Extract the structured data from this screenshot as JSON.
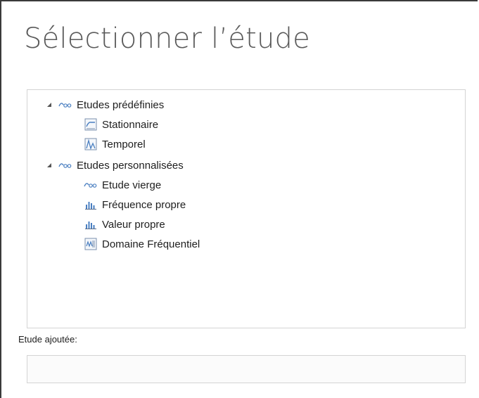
{
  "window": {
    "title": "Sélectionner l’étude"
  },
  "tree": {
    "groups": [
      {
        "label": "Etudes prédéfinies",
        "icon": "study-group-icon",
        "expanded": true,
        "items": [
          {
            "label": "Stationnaire",
            "icon": "stationary-study-icon"
          },
          {
            "label": "Temporel",
            "icon": "time-dependent-study-icon"
          }
        ]
      },
      {
        "label": "Etudes personnalisées",
        "icon": "study-group-icon",
        "expanded": true,
        "items": [
          {
            "label": "Etude vierge",
            "icon": "study-group-icon"
          },
          {
            "label": "Fréquence propre",
            "icon": "eigenfrequency-study-icon"
          },
          {
            "label": "Valeur propre",
            "icon": "eigenvalue-study-icon"
          },
          {
            "label": "Domaine Fréquentiel",
            "icon": "frequency-domain-study-icon"
          }
        ]
      }
    ]
  },
  "added_study": {
    "label": "Etude ajoutée:",
    "value": ""
  },
  "colors": {
    "accent": "#4a7fc1",
    "title_text": "#5a5a5a",
    "border": "#d4d4d4"
  }
}
